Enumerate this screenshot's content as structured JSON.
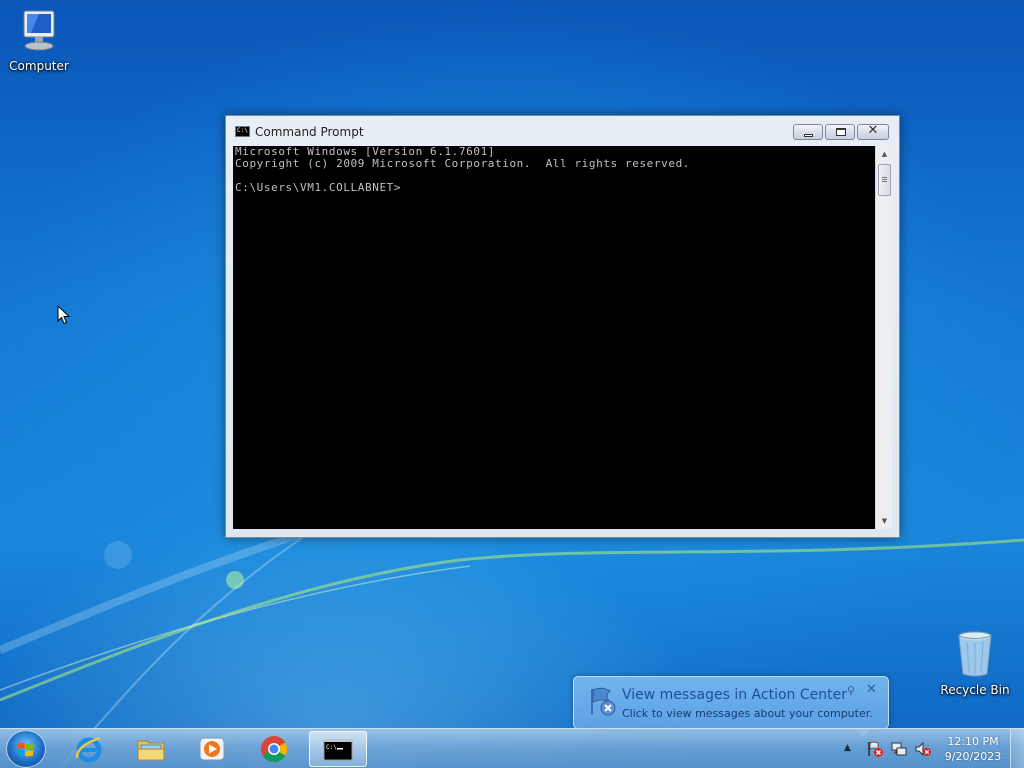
{
  "desktop": {
    "icons": [
      {
        "label": "Computer",
        "icon": "computer-icon"
      },
      {
        "label": "Recycle Bin",
        "icon": "recycle-bin-icon"
      }
    ]
  },
  "cmd_window": {
    "title": "Command Prompt",
    "console_lines": [
      "Microsoft Windows [Version 6.1.7601]",
      "Copyright (c) 2009 Microsoft Corporation.  All rights reserved.",
      "",
      "C:\\Users\\VM1.COLLABNET>"
    ],
    "buttons": [
      "minimize-icon",
      "maximize-icon",
      "close-icon"
    ],
    "close_glyph": "✕"
  },
  "notification": {
    "title": "View messages in Action Center",
    "text": "Click to view messages about your computer.",
    "close_glyph": "✕",
    "pin_glyph": "⚲"
  },
  "taskbar": {
    "pinned": [
      {
        "name": "Internet Explorer",
        "icon": "internet-explorer-icon"
      },
      {
        "name": "Windows Explorer",
        "icon": "folder-icon"
      },
      {
        "name": "Windows Media Player",
        "icon": "media-player-icon"
      },
      {
        "name": "Google Chrome",
        "icon": "chrome-icon"
      },
      {
        "name": "Command Prompt",
        "icon": "cmd-icon",
        "active": true
      }
    ],
    "tray_arrow": "▲",
    "tray_icons": [
      "action-center-flag-icon",
      "network-icon",
      "volume-muted-icon"
    ],
    "clock": {
      "time": "12:10 PM",
      "date": "9/20/2023"
    }
  },
  "colors": {
    "desktop_blue": "#1478d4",
    "console_bg": "#000000",
    "console_fg": "#c0c0c0",
    "balloon_title": "#1c4f9a"
  }
}
